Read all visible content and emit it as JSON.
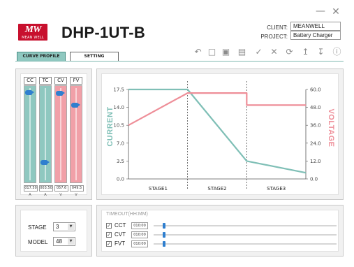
{
  "app": {
    "logo_text": "MW",
    "logo_subtext": "MEAN WELL",
    "model": "DHP-1UT-B",
    "window": {
      "minimize_icon": "minimize-icon",
      "close_icon": "close-icon"
    }
  },
  "info": {
    "client_label": "CLIENT:",
    "client_value": "MEANWELL",
    "project_label": "PROJECT:",
    "project_value": "Battery Charger"
  },
  "tabs": [
    {
      "label": "CURVE PROFILE",
      "active": true
    },
    {
      "label": "SETTING",
      "active": false
    }
  ],
  "toolbar": {
    "icons": [
      "undo-icon",
      "new-folder-icon",
      "open-folder-icon",
      "save-icon",
      "check-icon",
      "cancel-icon",
      "refresh-icon",
      "upload-icon",
      "download-icon",
      "info-icon"
    ]
  },
  "sliders": [
    {
      "label": "CC",
      "value": "017.50",
      "unit": "A",
      "color": "#8fc8c0",
      "level": 0.97
    },
    {
      "label": "TC",
      "value": "003.50",
      "unit": "A",
      "color": "#8fc8c0",
      "level": 0.19
    },
    {
      "label": "CV",
      "value": "057.6",
      "unit": "V",
      "color": "#f1a0a8",
      "level": 0.96
    },
    {
      "label": "FV",
      "value": "049.5",
      "unit": "V",
      "color": "#f1a0a8",
      "level": 0.83
    }
  ],
  "chart_labels": {
    "left_axis": "CURRENT",
    "right_axis": "VOLTAGE"
  },
  "chart_data": {
    "type": "line",
    "categories": [
      "STAGE1",
      "STAGE2",
      "STAGE3"
    ],
    "x_range": [
      0,
      3
    ],
    "left_ticks": [
      "17.5",
      "14.0",
      "10.5",
      "7.0",
      "3.5",
      "0.0"
    ],
    "right_ticks": [
      "60.0",
      "48.0",
      "36.0",
      "24.0",
      "12.0",
      "0.0"
    ],
    "ylim_left": [
      0,
      17.5
    ],
    "ylim_right": [
      0,
      60
    ],
    "stage_dividers": [
      1,
      2
    ],
    "series": [
      {
        "axis": "left",
        "color": "#7fbfb6",
        "x": [
          0,
          1,
          2,
          2,
          3
        ],
        "y": [
          17.5,
          17.5,
          3.5,
          3.5,
          1.2
        ]
      },
      {
        "axis": "right",
        "color": "#ee8e98",
        "x": [
          0,
          1,
          2,
          2,
          3
        ],
        "y": [
          36.0,
          57.6,
          57.6,
          49.5,
          49.5
        ]
      }
    ],
    "grid": false
  },
  "stage_model": {
    "stage_label": "STAGE",
    "stage_value": "3",
    "model_label": "MODEL",
    "model_value": "48"
  },
  "timeout": {
    "title": "TIMEOUT(HH:MM)",
    "rows": [
      {
        "label": "CCT",
        "checked": true,
        "value": "010:00",
        "level": 0.05
      },
      {
        "label": "CVT",
        "checked": true,
        "value": "010:00",
        "level": 0.05
      },
      {
        "label": "FVT",
        "checked": true,
        "value": "010:00",
        "level": 0.05
      }
    ]
  }
}
